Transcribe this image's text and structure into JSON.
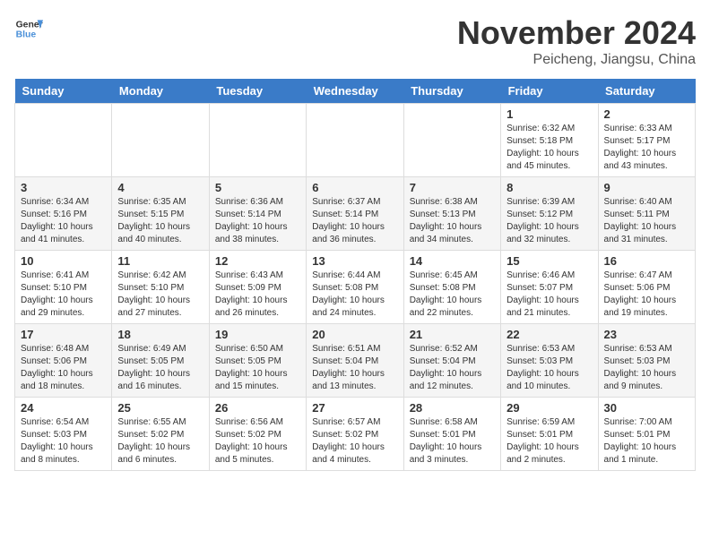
{
  "header": {
    "logo_line1": "General",
    "logo_line2": "Blue",
    "month_title": "November 2024",
    "subtitle": "Peicheng, Jiangsu, China"
  },
  "weekdays": [
    "Sunday",
    "Monday",
    "Tuesday",
    "Wednesday",
    "Thursday",
    "Friday",
    "Saturday"
  ],
  "weeks": [
    [
      {
        "day": "",
        "info": ""
      },
      {
        "day": "",
        "info": ""
      },
      {
        "day": "",
        "info": ""
      },
      {
        "day": "",
        "info": ""
      },
      {
        "day": "",
        "info": ""
      },
      {
        "day": "1",
        "info": "Sunrise: 6:32 AM\nSunset: 5:18 PM\nDaylight: 10 hours\nand 45 minutes."
      },
      {
        "day": "2",
        "info": "Sunrise: 6:33 AM\nSunset: 5:17 PM\nDaylight: 10 hours\nand 43 minutes."
      }
    ],
    [
      {
        "day": "3",
        "info": "Sunrise: 6:34 AM\nSunset: 5:16 PM\nDaylight: 10 hours\nand 41 minutes."
      },
      {
        "day": "4",
        "info": "Sunrise: 6:35 AM\nSunset: 5:15 PM\nDaylight: 10 hours\nand 40 minutes."
      },
      {
        "day": "5",
        "info": "Sunrise: 6:36 AM\nSunset: 5:14 PM\nDaylight: 10 hours\nand 38 minutes."
      },
      {
        "day": "6",
        "info": "Sunrise: 6:37 AM\nSunset: 5:14 PM\nDaylight: 10 hours\nand 36 minutes."
      },
      {
        "day": "7",
        "info": "Sunrise: 6:38 AM\nSunset: 5:13 PM\nDaylight: 10 hours\nand 34 minutes."
      },
      {
        "day": "8",
        "info": "Sunrise: 6:39 AM\nSunset: 5:12 PM\nDaylight: 10 hours\nand 32 minutes."
      },
      {
        "day": "9",
        "info": "Sunrise: 6:40 AM\nSunset: 5:11 PM\nDaylight: 10 hours\nand 31 minutes."
      }
    ],
    [
      {
        "day": "10",
        "info": "Sunrise: 6:41 AM\nSunset: 5:10 PM\nDaylight: 10 hours\nand 29 minutes."
      },
      {
        "day": "11",
        "info": "Sunrise: 6:42 AM\nSunset: 5:10 PM\nDaylight: 10 hours\nand 27 minutes."
      },
      {
        "day": "12",
        "info": "Sunrise: 6:43 AM\nSunset: 5:09 PM\nDaylight: 10 hours\nand 26 minutes."
      },
      {
        "day": "13",
        "info": "Sunrise: 6:44 AM\nSunset: 5:08 PM\nDaylight: 10 hours\nand 24 minutes."
      },
      {
        "day": "14",
        "info": "Sunrise: 6:45 AM\nSunset: 5:08 PM\nDaylight: 10 hours\nand 22 minutes."
      },
      {
        "day": "15",
        "info": "Sunrise: 6:46 AM\nSunset: 5:07 PM\nDaylight: 10 hours\nand 21 minutes."
      },
      {
        "day": "16",
        "info": "Sunrise: 6:47 AM\nSunset: 5:06 PM\nDaylight: 10 hours\nand 19 minutes."
      }
    ],
    [
      {
        "day": "17",
        "info": "Sunrise: 6:48 AM\nSunset: 5:06 PM\nDaylight: 10 hours\nand 18 minutes."
      },
      {
        "day": "18",
        "info": "Sunrise: 6:49 AM\nSunset: 5:05 PM\nDaylight: 10 hours\nand 16 minutes."
      },
      {
        "day": "19",
        "info": "Sunrise: 6:50 AM\nSunset: 5:05 PM\nDaylight: 10 hours\nand 15 minutes."
      },
      {
        "day": "20",
        "info": "Sunrise: 6:51 AM\nSunset: 5:04 PM\nDaylight: 10 hours\nand 13 minutes."
      },
      {
        "day": "21",
        "info": "Sunrise: 6:52 AM\nSunset: 5:04 PM\nDaylight: 10 hours\nand 12 minutes."
      },
      {
        "day": "22",
        "info": "Sunrise: 6:53 AM\nSunset: 5:03 PM\nDaylight: 10 hours\nand 10 minutes."
      },
      {
        "day": "23",
        "info": "Sunrise: 6:53 AM\nSunset: 5:03 PM\nDaylight: 10 hours\nand 9 minutes."
      }
    ],
    [
      {
        "day": "24",
        "info": "Sunrise: 6:54 AM\nSunset: 5:03 PM\nDaylight: 10 hours\nand 8 minutes."
      },
      {
        "day": "25",
        "info": "Sunrise: 6:55 AM\nSunset: 5:02 PM\nDaylight: 10 hours\nand 6 minutes."
      },
      {
        "day": "26",
        "info": "Sunrise: 6:56 AM\nSunset: 5:02 PM\nDaylight: 10 hours\nand 5 minutes."
      },
      {
        "day": "27",
        "info": "Sunrise: 6:57 AM\nSunset: 5:02 PM\nDaylight: 10 hours\nand 4 minutes."
      },
      {
        "day": "28",
        "info": "Sunrise: 6:58 AM\nSunset: 5:01 PM\nDaylight: 10 hours\nand 3 minutes."
      },
      {
        "day": "29",
        "info": "Sunrise: 6:59 AM\nSunset: 5:01 PM\nDaylight: 10 hours\nand 2 minutes."
      },
      {
        "day": "30",
        "info": "Sunrise: 7:00 AM\nSunset: 5:01 PM\nDaylight: 10 hours\nand 1 minute."
      }
    ]
  ]
}
